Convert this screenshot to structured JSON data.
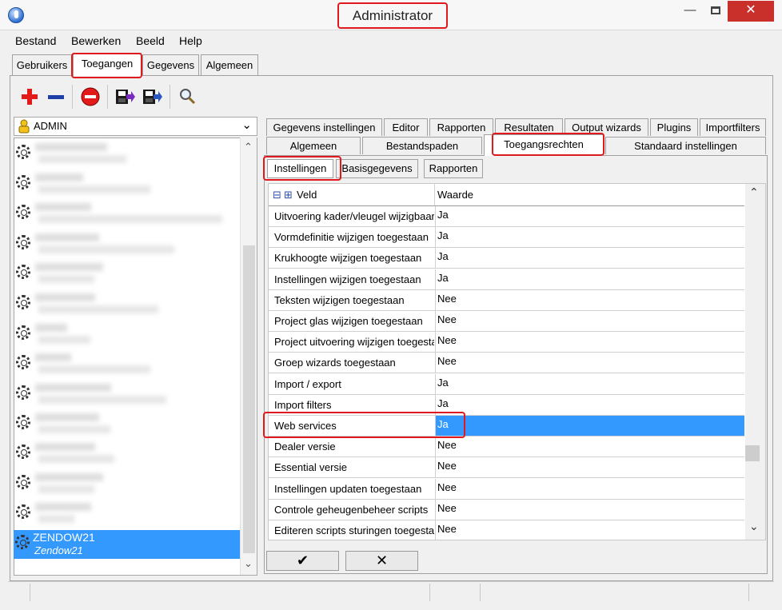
{
  "window": {
    "title": "Administrator",
    "minimize_glyph": "—",
    "close_glyph": "✕"
  },
  "menu": [
    "Bestand",
    "Bewerken",
    "Beeld",
    "Help"
  ],
  "main_tabs": [
    "Gebruikers",
    "Toegangen",
    "Gegevens",
    "Algemeen"
  ],
  "toolbar": {
    "icons": [
      "add-icon",
      "remove-icon",
      "block-icon",
      "import-icon",
      "export-icon",
      "search-icon"
    ]
  },
  "user_combo": {
    "value": "ADMIN",
    "chevron": "⌄"
  },
  "users": {
    "selected_name": "ZENDOW21",
    "selected_sub": "Zendow21"
  },
  "right_tabs_row1": [
    "Gegevens instellingen",
    "Editor",
    "Rapporten",
    "Resultaten",
    "Output wizards",
    "Plugins",
    "Importfilters"
  ],
  "right_tabs_row2": [
    "Algemeen",
    "Bestandspaden",
    "Toegangsrechten",
    "Standaard instellingen"
  ],
  "sub_tabs": [
    "Instellingen",
    "Basisgegevens",
    "Rapporten"
  ],
  "grid": {
    "headers": {
      "expand": "⊟",
      "collapse": "⊞",
      "veld": "Veld",
      "waarde": "Waarde"
    },
    "rows": [
      {
        "veld": "Uitvoering kader/vleugel wijzigbaar",
        "waarde": "Ja"
      },
      {
        "veld": "Vormdefinitie wijzigen toegestaan",
        "waarde": "Ja"
      },
      {
        "veld": "Krukhoogte wijzigen toegestaan",
        "waarde": "Ja"
      },
      {
        "veld": "Instellingen wijzigen toegestaan",
        "waarde": "Ja"
      },
      {
        "veld": "Teksten wijzigen toegestaan",
        "waarde": "Nee"
      },
      {
        "veld": "Project glas wijzigen toegestaan",
        "waarde": "Nee"
      },
      {
        "veld": "Project uitvoering wijzigen toegestaan",
        "waarde": "Nee"
      },
      {
        "veld": "Groep wizards toegestaan",
        "waarde": "Nee"
      },
      {
        "veld": "Import / export",
        "waarde": "Ja"
      },
      {
        "veld": "Import filters",
        "waarde": "Ja"
      },
      {
        "veld": "Web services",
        "waarde": "Ja"
      },
      {
        "veld": "Dealer versie",
        "waarde": "Nee"
      },
      {
        "veld": "Essential versie",
        "waarde": "Nee"
      },
      {
        "veld": "Instellingen updaten toegestaan",
        "waarde": "Nee"
      },
      {
        "veld": "Controle geheugenbeheer scripts",
        "waarde": "Nee"
      },
      {
        "veld": "Editeren scripts sturingen toegestaan",
        "waarde": "Nee"
      }
    ],
    "selected_row": 10,
    "up_glyph": "⌃",
    "down_glyph": "⌄"
  },
  "buttons": {
    "ok": "✔",
    "cancel": "✕"
  },
  "colors": {
    "selection": "#3399ff",
    "highlight": "#e0191e",
    "close": "#c9302c"
  }
}
